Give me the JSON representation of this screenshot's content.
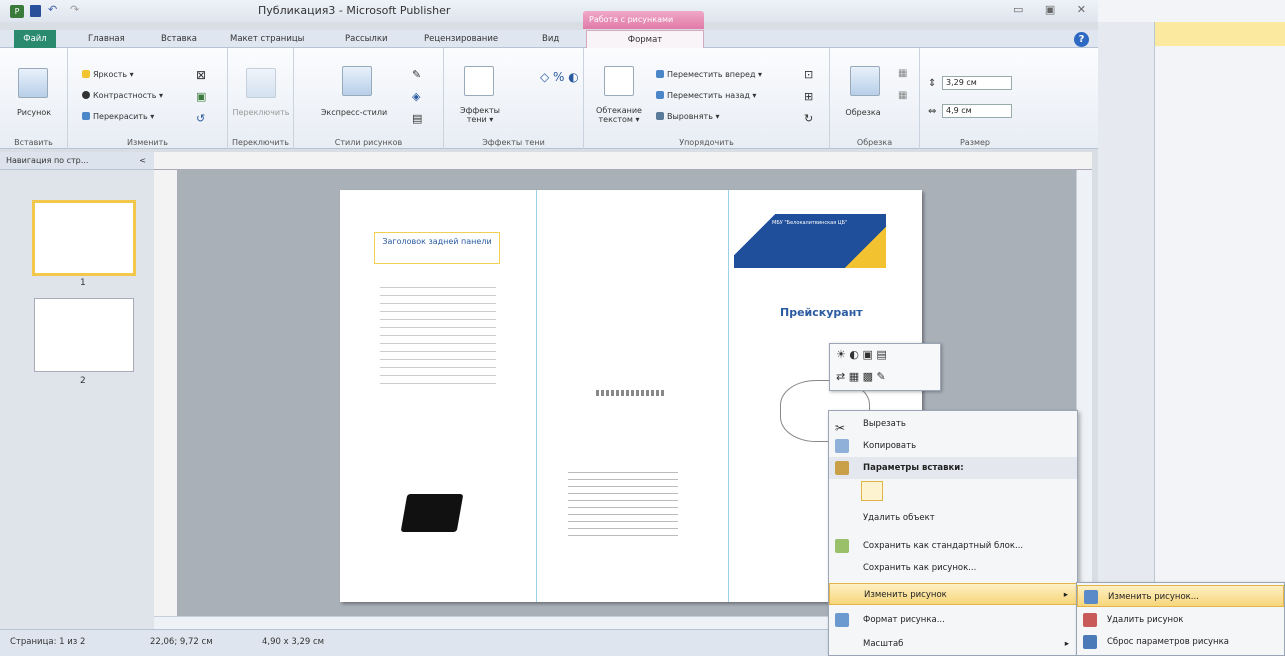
{
  "window": {
    "title": "Публикация3 - Microsoft Publisher",
    "context_tab": "Работа с рисунками"
  },
  "quick_access": {
    "app_icon": "P"
  },
  "tabs": [
    "Файл",
    "Главная",
    "Вставка",
    "Макет страницы",
    "Рассылки",
    "Рецензирование",
    "Вид",
    "Формат"
  ],
  "ribbon": {
    "insert_group": {
      "button": "Рисунок",
      "name": "Вставить"
    },
    "adjust_group": {
      "brightness": "Яркость",
      "contrast": "Контрастность",
      "recolor": "Перекрасить",
      "name": "Изменить"
    },
    "swap_group": {
      "button": "Переключить",
      "name": "Переключить"
    },
    "styles_group": {
      "button": "Экспресс-стили",
      "name": "Стили рисунков"
    },
    "effects_group": {
      "button_line1": "Эффекты",
      "button_line2": "тени",
      "name": "Эффекты тени"
    },
    "arrange_group": {
      "wrap_line1": "Обтекание",
      "wrap_line2": "текстом",
      "forward": "Переместить вперед",
      "backward": "Переместить назад",
      "align": "Выровнять",
      "name": "Упорядочить"
    },
    "crop_group": {
      "button": "Обрезка",
      "name": "Обрезка"
    },
    "size_group": {
      "height": "3,29 см",
      "width": "4,9 см",
      "name": "Размер"
    }
  },
  "nav": {
    "title": "Навигация по стр...",
    "pages": [
      "1",
      "2"
    ]
  },
  "page_content": {
    "left_heading": "Заголовок задней панели",
    "price_title": "Прейскурант",
    "banner_text": "МБУ \"Белокалитвинская ЦБ\""
  },
  "mini_toolbar": {},
  "context_menu": {
    "items": [
      {
        "label": "Вырезать",
        "icon": "scissors-icon"
      },
      {
        "label": "Копировать",
        "icon": "copy-icon"
      },
      {
        "label": "Параметры вставки:",
        "icon": "paste-icon"
      },
      {
        "label": "Удалить объект",
        "icon": ""
      },
      {
        "label": "Сохранить как стандартный блок...",
        "icon": "building-block-icon"
      },
      {
        "label": "Сохранить как рисунок...",
        "icon": ""
      },
      {
        "label": "Изменить рисунок",
        "icon": ""
      },
      {
        "label": "Формат рисунка...",
        "icon": "format-picture-icon"
      },
      {
        "label": "Масштаб",
        "icon": ""
      }
    ]
  },
  "submenu": {
    "items": [
      {
        "label": "Изменить рисунок..."
      },
      {
        "label": "Удалить рисунок"
      },
      {
        "label": "Сброс параметров рисунка"
      }
    ]
  },
  "status": {
    "page": "Страница: 1 из 2",
    "position": "22,06; 9,72 см",
    "size": "4,90 x 3,29 см"
  },
  "colors": {
    "file_tab": "#2a8a6e",
    "context_tab": "#e07aa8",
    "highlight": "#f8d67a",
    "banner": "#1f4e9a"
  }
}
